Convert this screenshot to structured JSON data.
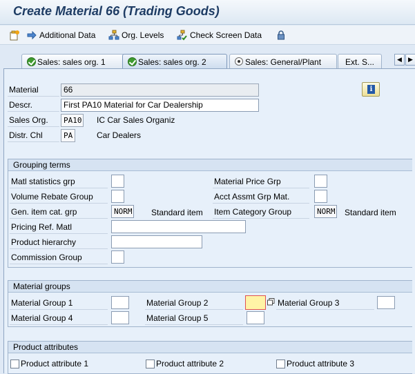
{
  "window": {
    "title": "Create Material 66 (Trading Goods)"
  },
  "toolbar": {
    "additional_data": "Additional Data",
    "org_levels": "Org. Levels",
    "check_screen_data": "Check Screen Data"
  },
  "tabs": [
    {
      "label": "Sales: sales org. 1",
      "state": "check"
    },
    {
      "label": "Sales: sales org. 2",
      "state": "check",
      "active": true
    },
    {
      "label": "Sales: General/Plant",
      "state": "radio"
    },
    {
      "label": "Ext. S..."
    }
  ],
  "header": {
    "material_label": "Material",
    "material_value": "66",
    "descr_label": "Descr.",
    "descr_value": "First PA10 Material for Car Dealership",
    "sales_org_label": "Sales Org.",
    "sales_org_value": "PA10",
    "sales_org_text": "IC Car Sales Organiz",
    "distr_chl_label": "Distr. Chl",
    "distr_chl_value": "PA",
    "distr_chl_text": "Car Dealers"
  },
  "grouping": {
    "title": "Grouping terms",
    "matl_stat_grp": "Matl statistics grp",
    "material_price_grp": "Material Price Grp",
    "volume_rebate_group": "Volume Rebate Group",
    "acct_assmt_grp": "Acct Assmt Grp Mat.",
    "gen_item_cat_grp": "Gen. item cat. grp",
    "gen_item_cat_value": "NORM",
    "gen_item_cat_text": "Standard item",
    "item_category_group": "Item Category Group",
    "item_category_value": "NORM",
    "item_category_text": "Standard item",
    "pricing_ref_matl": "Pricing Ref. Matl",
    "product_hierarchy": "Product hierarchy",
    "commission_group": "Commission Group"
  },
  "material_groups": {
    "title": "Material groups",
    "mg1": "Material Group 1",
    "mg2": "Material Group 2",
    "mg3": "Material Group 3",
    "mg4": "Material Group 4",
    "mg5": "Material Group 5"
  },
  "product_attributes": {
    "title": "Product attributes",
    "attr1": "Product attribute 1",
    "attr2": "Product attribute 2",
    "attr3": "Product attribute 3"
  },
  "icons": {
    "create": "new-document-icon",
    "additional_data": "arrow-right-icon",
    "org_levels": "hierarchy-icon",
    "check": "check-screen-icon",
    "lock": "lock-icon",
    "info": "info-icon"
  }
}
